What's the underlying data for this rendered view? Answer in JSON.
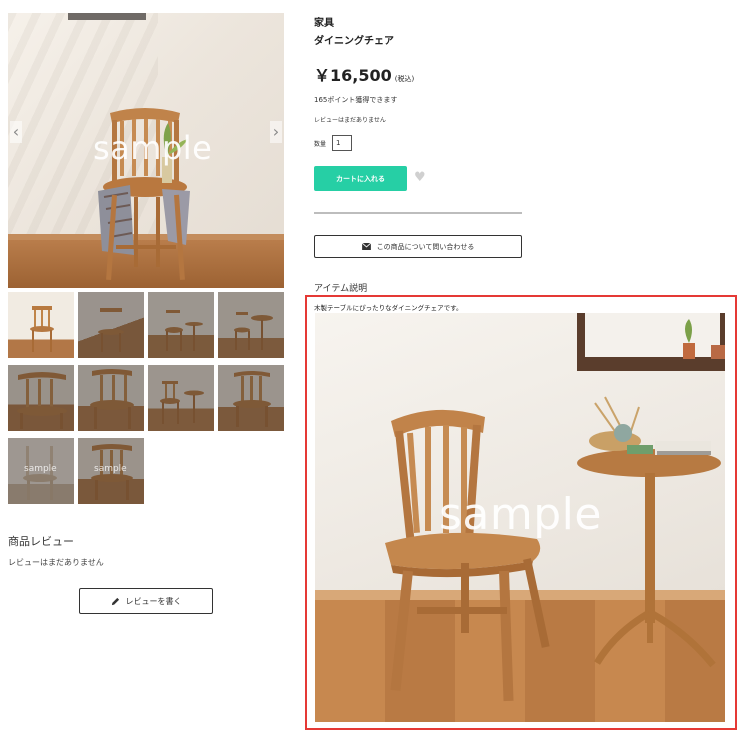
{
  "gallery": {
    "watermark": "sample",
    "prev_icon": "chevron-left-icon",
    "next_icon": "chevron-right-icon",
    "thumbnail_watermark": "sample"
  },
  "reviews": {
    "heading": "商品レビュー",
    "empty_text": "レビューはまだありません",
    "write_button_label": "レビューを書く",
    "write_button_icon": "pencil-icon"
  },
  "product": {
    "category": "家具",
    "name": "ダイニングチェア",
    "price": "￥16,500",
    "tax_note": "(税込)",
    "points_text": "165ポイント獲得できます",
    "review_status": "レビューはまだありません",
    "quantity_label": "数量",
    "quantity_value": "1",
    "cart_button_label": "カートに入れる",
    "favorite_icon": "heart-icon",
    "contact_button_label": "この商品について問い合わせる",
    "contact_icon": "envelope-icon"
  },
  "description": {
    "heading": "アイテム説明",
    "text": "木製テーブルにぴったりなダイニングチェアです。",
    "image_watermark": "sample"
  },
  "colors": {
    "cart_button": "#26cfa5",
    "highlight_border": "#e53935"
  }
}
